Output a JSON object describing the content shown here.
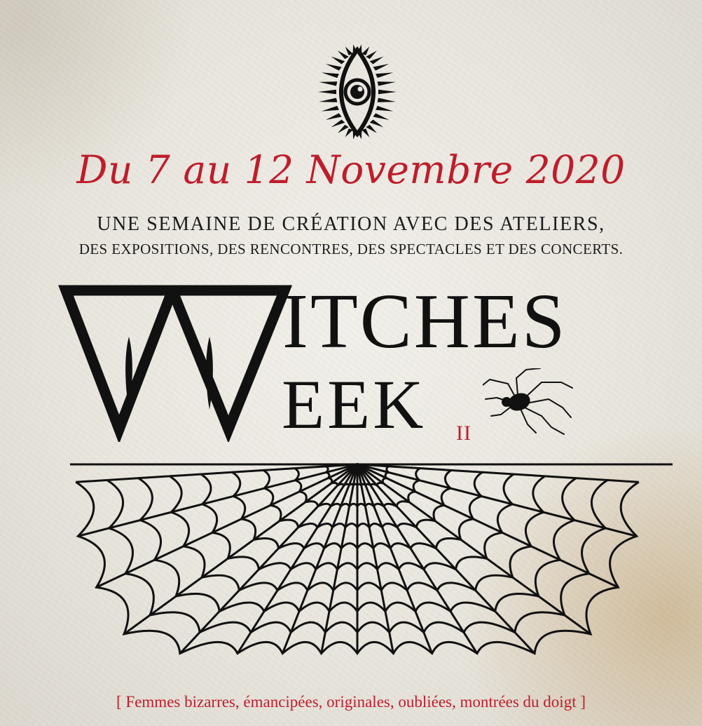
{
  "poster": {
    "date": "Du 7 au 12 Novembre 2020",
    "subtitle_line_1": "UNE SEMAINE DE CRÉATION AVEC DES ATELIERS,",
    "subtitle_line_2": "DES EXPOSITIONS, DES RENCONTRES, DES SPECTACLES ET DES CONCERTS.",
    "wordmark_line_1": "ITCHES",
    "wordmark_line_2": "EEK",
    "edition": "II",
    "tagline": "[ Femmes bizarres, émancipées, originales, oubliées, montrées du doigt ]",
    "logo_text": "WITCHES WEEK II"
  },
  "icons": {
    "top_symbol": "eye-icon",
    "logo": "double-w-triangle-logo",
    "spider": "spider-icon",
    "web": "spider-web"
  },
  "colors": {
    "accent_red": "#c01d2b",
    "ink": "#111111",
    "paper": "#ebe8e1"
  }
}
